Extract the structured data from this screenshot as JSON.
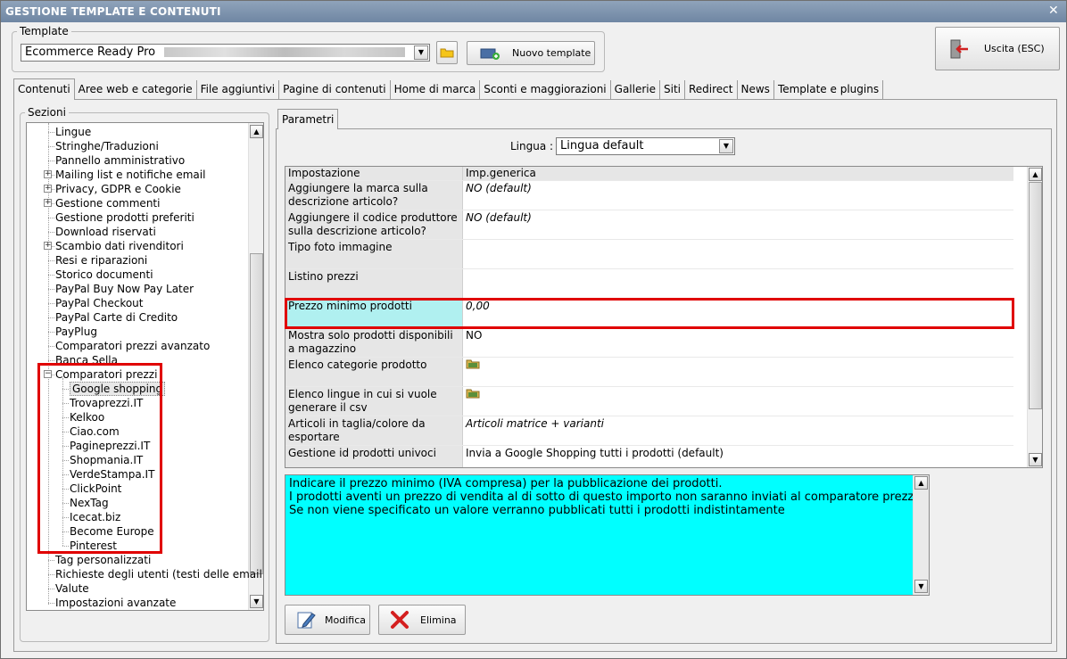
{
  "window": {
    "title": "GESTIONE TEMPLATE E CONTENUTI"
  },
  "template": {
    "group_label": "Template",
    "selected": "Ecommerce Ready Pro",
    "new_button": "Nuovo template",
    "exit_button": "Uscita (ESC)"
  },
  "tabs": [
    "Contenuti",
    "Aree web e categorie",
    "File aggiuntivi",
    "Pagine di contenuti",
    "Home di marca",
    "Sconti e maggiorazioni",
    "Gallerie",
    "Siti",
    "Redirect",
    "News",
    "Template e plugins"
  ],
  "sections": {
    "label": "Sezioni",
    "items": [
      {
        "label": "Lingue",
        "level": 0,
        "expander": ""
      },
      {
        "label": "Stringhe/Traduzioni",
        "level": 0,
        "expander": ""
      },
      {
        "label": "Pannello amministrativo",
        "level": 0,
        "expander": ""
      },
      {
        "label": "Mailing list e notifiche email",
        "level": 0,
        "expander": "+"
      },
      {
        "label": "Privacy, GDPR e Cookie",
        "level": 0,
        "expander": "+"
      },
      {
        "label": "Gestione commenti",
        "level": 0,
        "expander": "+"
      },
      {
        "label": "Gestione prodotti preferiti",
        "level": 0,
        "expander": ""
      },
      {
        "label": "Download riservati",
        "level": 0,
        "expander": ""
      },
      {
        "label": "Scambio dati rivenditori",
        "level": 0,
        "expander": "+"
      },
      {
        "label": "Resi e riparazioni",
        "level": 0,
        "expander": ""
      },
      {
        "label": "Storico documenti",
        "level": 0,
        "expander": ""
      },
      {
        "label": "PayPal Buy Now Pay Later",
        "level": 0,
        "expander": ""
      },
      {
        "label": "PayPal Checkout",
        "level": 0,
        "expander": ""
      },
      {
        "label": "PayPal Carte di Credito",
        "level": 0,
        "expander": ""
      },
      {
        "label": "PayPlug",
        "level": 0,
        "expander": ""
      },
      {
        "label": "Comparatori prezzi avanzato",
        "level": 0,
        "expander": ""
      },
      {
        "label": "Banca Sella",
        "level": 0,
        "expander": ""
      },
      {
        "label": "Comparatori prezzi",
        "level": 0,
        "expander": "−"
      },
      {
        "label": "Google shopping",
        "level": 1,
        "expander": "",
        "selected": true
      },
      {
        "label": "Trovaprezzi.IT",
        "level": 1,
        "expander": ""
      },
      {
        "label": "Kelkoo",
        "level": 1,
        "expander": ""
      },
      {
        "label": "Ciao.com",
        "level": 1,
        "expander": ""
      },
      {
        "label": "Pagineprezzi.IT",
        "level": 1,
        "expander": ""
      },
      {
        "label": "Shopmania.IT",
        "level": 1,
        "expander": ""
      },
      {
        "label": "VerdeStampa.IT",
        "level": 1,
        "expander": ""
      },
      {
        "label": "ClickPoint",
        "level": 1,
        "expander": ""
      },
      {
        "label": "NexTag",
        "level": 1,
        "expander": ""
      },
      {
        "label": "Icecat.biz",
        "level": 1,
        "expander": ""
      },
      {
        "label": "Become Europe",
        "level": 1,
        "expander": ""
      },
      {
        "label": "Pinterest",
        "level": 1,
        "expander": ""
      },
      {
        "label": "Tag personalizzati",
        "level": 0,
        "expander": ""
      },
      {
        "label": "Richieste degli utenti (testi delle email)",
        "level": 0,
        "expander": ""
      },
      {
        "label": "Valute",
        "level": 0,
        "expander": ""
      },
      {
        "label": "Impostazioni avanzate",
        "level": 0,
        "expander": ""
      }
    ]
  },
  "params": {
    "tab": "Parametri",
    "lingua_label": "Lingua :",
    "lingua_value": "Lingua default",
    "header_left": "Impostazione",
    "header_right": "Imp.generica",
    "rows": [
      {
        "label": "Aggiungere la marca sulla descrizione articolo?",
        "value": "NO (default)",
        "italic": true
      },
      {
        "label": "Aggiungere il codice produttore sulla descrizione articolo?",
        "value": "NO (default)",
        "italic": true
      },
      {
        "label": "Tipo foto immagine",
        "value": "",
        "italic": false
      },
      {
        "label": "Listino prezzi",
        "value": "",
        "italic": false
      },
      {
        "label": "Prezzo minimo prodotti",
        "value": "0,00",
        "italic": true,
        "highlight": true
      },
      {
        "label": "Mostra solo prodotti disponibili a magazzino",
        "value": "NO",
        "italic": false
      },
      {
        "label": "Elenco categorie prodotto",
        "value": "",
        "icon": "folder-icon"
      },
      {
        "label": "Elenco lingue in cui si vuole generare il csv",
        "value": "",
        "icon": "folder-icon"
      },
      {
        "label": "Articoli in taglia/colore da esportare",
        "value": "Articoli matrice + varianti",
        "italic": true
      },
      {
        "label": "Gestione id prodotti univoci",
        "value": "Invia a Google Shopping tutti i prodotti (default)",
        "italic": false
      }
    ],
    "description": [
      "Indicare il prezzo minimo (IVA compresa) per la pubblicazione dei prodotti.",
      "I prodotti aventi un prezzo di vendita al di sotto di questo importo non saranno inviati al comparatore prezzi.",
      "Se non viene specificato un valore verranno pubblicati tutti i prodotti indistintamente"
    ],
    "modify_button": "Modifica",
    "delete_button": "Elimina"
  },
  "colors": {
    "highlight_cell": "#b0f0f0",
    "description_bg": "#00ffff",
    "annotation": "#e00000"
  }
}
